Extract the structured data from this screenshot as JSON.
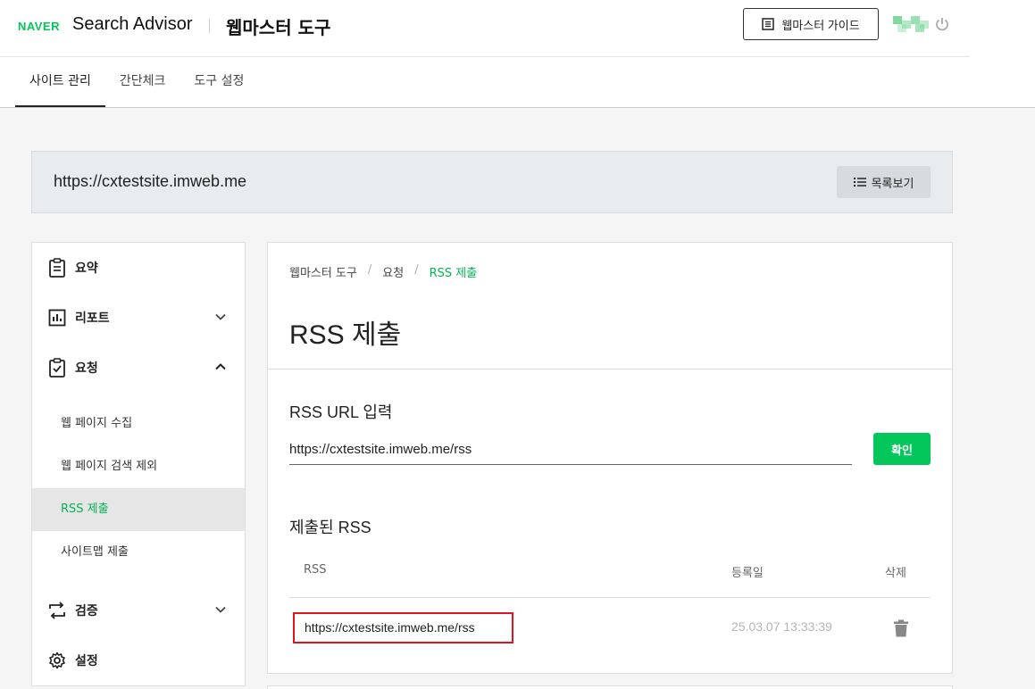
{
  "header": {
    "naver": "NAVER",
    "brand": "Search Advisor",
    "tool_name": "웹마스터 도구",
    "guide_button": "웹마스터 가이드"
  },
  "tabs": [
    {
      "label": "사이트 관리"
    },
    {
      "label": "간단체크"
    },
    {
      "label": "도구 설정"
    }
  ],
  "site": {
    "url": "https://cxtestsite.imweb.me",
    "list_button": "목록보기"
  },
  "sidebar": {
    "summary": "요약",
    "report": "리포트",
    "request": "요청",
    "request_items": [
      {
        "label": "웹 페이지 수집"
      },
      {
        "label": "웹 페이지 검색 제외"
      },
      {
        "label": "RSS 제출"
      },
      {
        "label": "사이트맵 제출"
      }
    ],
    "verify": "검증",
    "settings": "설정"
  },
  "main": {
    "breadcrumb": [
      "웹마스터 도구",
      "요청",
      "RSS 제출"
    ],
    "title": "RSS 제출",
    "input_label": "RSS URL 입력",
    "input_value": "https://cxtestsite.imweb.me/rss",
    "confirm_button": "확인",
    "submitted_title": "제출된 RSS",
    "table": {
      "headers": {
        "rss": "RSS",
        "date": "등록일",
        "delete": "삭제"
      },
      "rows": [
        {
          "rss": "https://cxtestsite.imweb.me/rss",
          "date": "25.03.07 13:33:39"
        }
      ]
    }
  },
  "colors": {
    "accent": "#03c75a",
    "highlight_border": "#e0141e"
  }
}
